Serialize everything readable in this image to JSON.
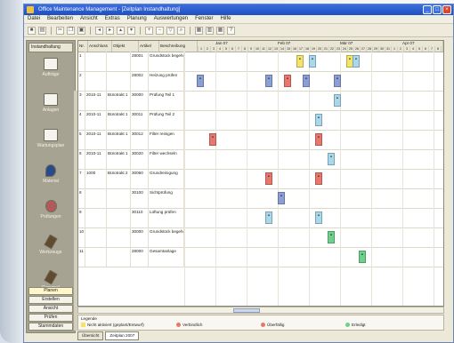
{
  "window": {
    "title": "Office Maintenance Management - [Zeitplan Instandhaltung]"
  },
  "menu": [
    "Datei",
    "Bearbeiten",
    "Ansicht",
    "Extras",
    "Planung",
    "Auswertungen",
    "Fenster",
    "Hilfe"
  ],
  "sidebar": {
    "header": "Instandhaltung",
    "items": [
      {
        "label": "Aufträge",
        "icon": "document-icon"
      },
      {
        "label": "Anlagen",
        "icon": "document-icon"
      },
      {
        "label": "Wartungsplan",
        "icon": "document-icon"
      },
      {
        "label": "Material",
        "icon": "drop-icon"
      },
      {
        "label": "Prüfungen",
        "icon": "certificate-icon"
      },
      {
        "label": "Werkzeuge",
        "icon": "tool-icon"
      },
      {
        "label": "Personal",
        "icon": "tool-icon"
      }
    ],
    "tabs": [
      "Planen",
      "Erstellen",
      "Ansicht",
      "Prüfen",
      "Stammdaten"
    ]
  },
  "grid": {
    "headers": [
      "Nr.",
      "Anschluss",
      "Objekt",
      "Artikel",
      "Beschreibung"
    ],
    "months": [
      "Jan 07",
      "Feb 07",
      "Mär 07",
      "Apr 07"
    ],
    "rows": [
      {
        "n": "1",
        "a": "",
        "o": "",
        "art": "28001",
        "desc": "Grundstück begehen"
      },
      {
        "n": "2",
        "a": "",
        "o": "",
        "art": "28002",
        "desc": "Heizung prüfen"
      },
      {
        "n": "3",
        "a": "2010-11",
        "o": "Bürotrakt 1",
        "art": "30000",
        "desc": "Prüfung Teil 1"
      },
      {
        "n": "4",
        "a": "2010-11",
        "o": "Bürotrakt 1",
        "art": "30011",
        "desc": "Prüfung Teil 2"
      },
      {
        "n": "5",
        "a": "2010-11",
        "o": "Bürotrakt 1",
        "art": "30012",
        "desc": "Filter reinigen"
      },
      {
        "n": "6",
        "a": "2010-11",
        "o": "Bürotrakt 1",
        "art": "30020",
        "desc": "Filter wechseln"
      },
      {
        "n": "7",
        "a": "1000",
        "o": "Bürotrakt 2",
        "art": "30060",
        "desc": "Grundreinigung"
      },
      {
        "n": "8",
        "a": "",
        "o": "",
        "art": "30100",
        "desc": "Sichtprüfung"
      },
      {
        "n": "9",
        "a": "",
        "o": "",
        "art": "30110",
        "desc": "Lüftung prüfen"
      },
      {
        "n": "10",
        "a": "",
        "o": "",
        "art": "30000",
        "desc": "Grundstück begehen"
      },
      {
        "n": "11",
        "a": "",
        "o": "",
        "art": "28000",
        "desc": "Gesamtanlage"
      }
    ]
  },
  "bars": [
    {
      "row": 0,
      "day": 18,
      "color": "#f4e46a"
    },
    {
      "row": 0,
      "day": 20,
      "color": "#a8d8ea"
    },
    {
      "row": 0,
      "day": 26,
      "color": "#f4e46a"
    },
    {
      "row": 0,
      "day": 27,
      "color": "#a8d8ea"
    },
    {
      "row": 1,
      "day": 2,
      "color": "#8b9fd6"
    },
    {
      "row": 1,
      "day": 13,
      "color": "#8b9fd6"
    },
    {
      "row": 1,
      "day": 16,
      "color": "#e8776e"
    },
    {
      "row": 1,
      "day": 19,
      "color": "#8b9fd6"
    },
    {
      "row": 1,
      "day": 24,
      "color": "#8b9fd6"
    },
    {
      "row": 2,
      "day": 24,
      "color": "#a8d8ea"
    },
    {
      "row": 3,
      "day": 21,
      "color": "#a8d8ea"
    },
    {
      "row": 4,
      "day": 4,
      "color": "#e8776e"
    },
    {
      "row": 4,
      "day": 21,
      "color": "#e8776e"
    },
    {
      "row": 5,
      "day": 23,
      "color": "#a8d8ea"
    },
    {
      "row": 6,
      "day": 13,
      "color": "#e8776e"
    },
    {
      "row": 6,
      "day": 21,
      "color": "#e8776e"
    },
    {
      "row": 7,
      "day": 15,
      "color": "#8b9fd6"
    },
    {
      "row": 8,
      "day": 13,
      "color": "#a8d8ea"
    },
    {
      "row": 8,
      "day": 21,
      "color": "#a8d8ea"
    },
    {
      "row": 9,
      "day": 23,
      "color": "#6fd08a"
    },
    {
      "row": 10,
      "day": 28,
      "color": "#6fd08a"
    }
  ],
  "legend": {
    "title": "Legende",
    "items": [
      {
        "label": "Nicht aktiviert (geplant/Entwurf)",
        "color": "#f4e46a",
        "box": true
      },
      {
        "label": "Verbindlich",
        "color": "#e8776e",
        "box": false
      },
      {
        "label": "Überfällig",
        "color": "#e8776e",
        "box": false
      },
      {
        "label": "Erledigt",
        "color": "#6fd08a",
        "box": false
      }
    ]
  },
  "bottom_tabs": [
    "Übersicht",
    "Zeitplan 2007"
  ]
}
